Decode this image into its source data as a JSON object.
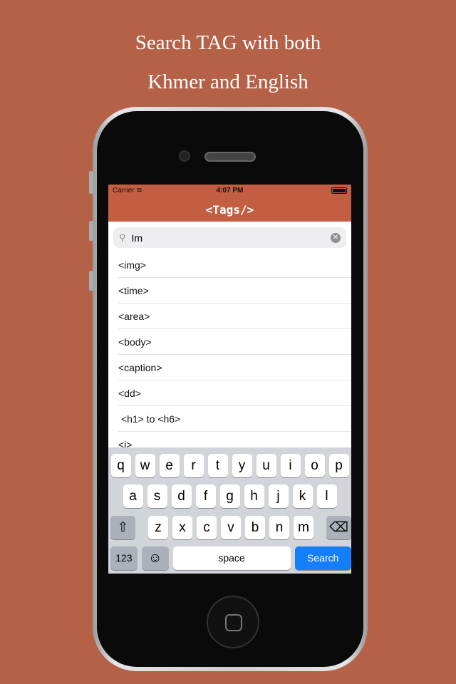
{
  "promo": {
    "line1": "Search TAG with both",
    "line2": "Khmer and English"
  },
  "status": {
    "carrier": "Carrier",
    "time": "4:07 PM"
  },
  "nav": {
    "title": "<Tags/>"
  },
  "search": {
    "value": "Im"
  },
  "results": [
    "<img>",
    "<time>",
    "<area>",
    "<body>",
    "<caption>",
    "<dd>",
    " <h1> to <h6>",
    "<i>"
  ],
  "keyboard": {
    "row1": [
      "q",
      "w",
      "e",
      "r",
      "t",
      "y",
      "u",
      "i",
      "o",
      "p"
    ],
    "row2": [
      "a",
      "s",
      "d",
      "f",
      "g",
      "h",
      "j",
      "k",
      "l"
    ],
    "row3": [
      "z",
      "x",
      "c",
      "v",
      "b",
      "n",
      "m"
    ],
    "numbers": "123",
    "space": "space",
    "search": "Search",
    "shift_icon": "⇧",
    "delete_icon": "⌫",
    "emoji_icon": "☺"
  },
  "colors": {
    "background": "#b46148",
    "nav": "#c35e42",
    "search_key": "#147efb"
  }
}
